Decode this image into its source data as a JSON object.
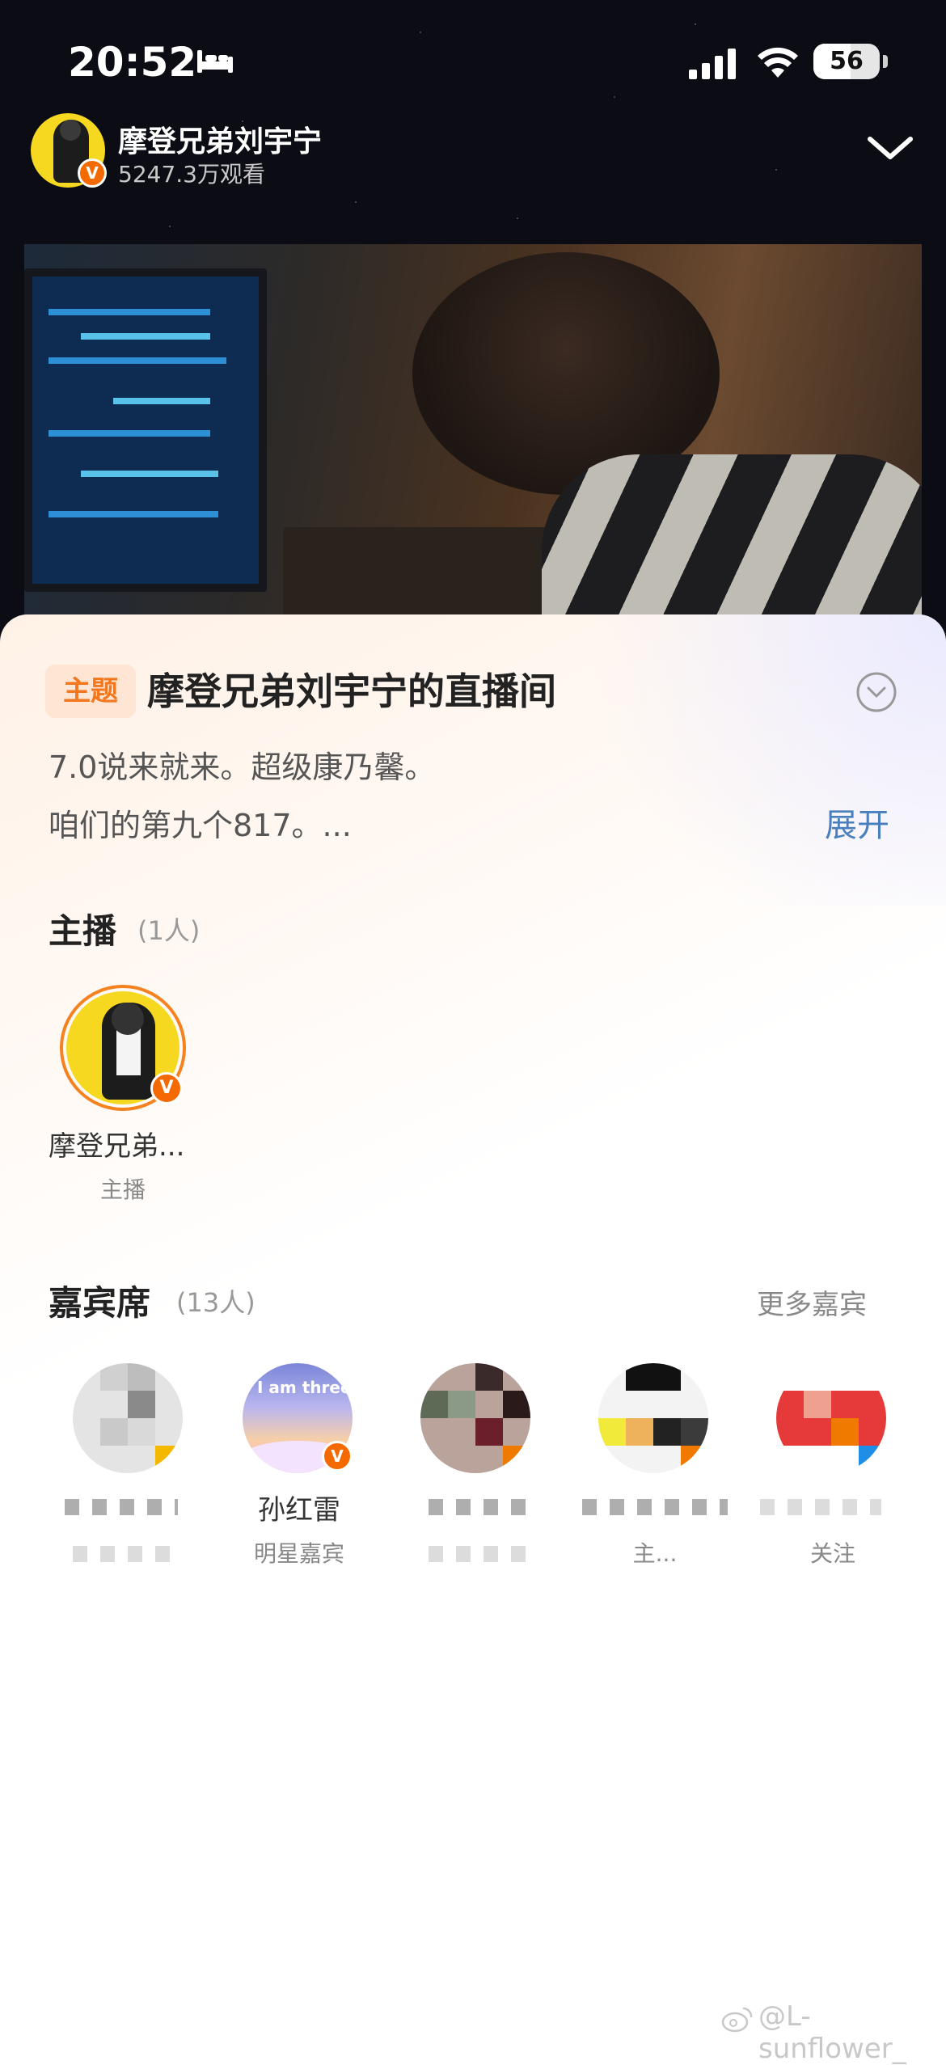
{
  "status_bar": {
    "time": "20:52",
    "battery": "56",
    "icons": [
      "bed-icon",
      "signal-icon",
      "wifi-icon",
      "battery-icon"
    ]
  },
  "header": {
    "host_name": "摩登兄弟刘宇宁",
    "views": "5247.3万观看",
    "collapse_icon": "chevron-down-icon"
  },
  "panel": {
    "topic_tag": "主题",
    "title": "摩登兄弟刘宇宁的直播间",
    "description_line1": "7.0说来就来。超级康乃馨。",
    "description_line2": "咱们的第九个817。...",
    "expand_label": "展开"
  },
  "anchors": {
    "title": "主播",
    "count": "(1人)",
    "items": [
      {
        "name": "摩登兄弟...",
        "role": "主播"
      }
    ]
  },
  "guests": {
    "title": "嘉宾席",
    "count": "(13人)",
    "more_label": "更多嘉宾",
    "items": [
      {
        "name": "",
        "role": ""
      },
      {
        "name": "孙红雷",
        "role": "明星嘉宾",
        "avatar_text": "I am three"
      },
      {
        "name": "",
        "role": ""
      },
      {
        "name": "",
        "role": "主..."
      },
      {
        "name": "",
        "role": "关注"
      }
    ]
  },
  "watermark": "@L-sunflower_",
  "colors": {
    "accent_orange": "#f56a00",
    "topic_tag_bg": "#ffe5d3",
    "link_blue": "#4a7fbd"
  }
}
